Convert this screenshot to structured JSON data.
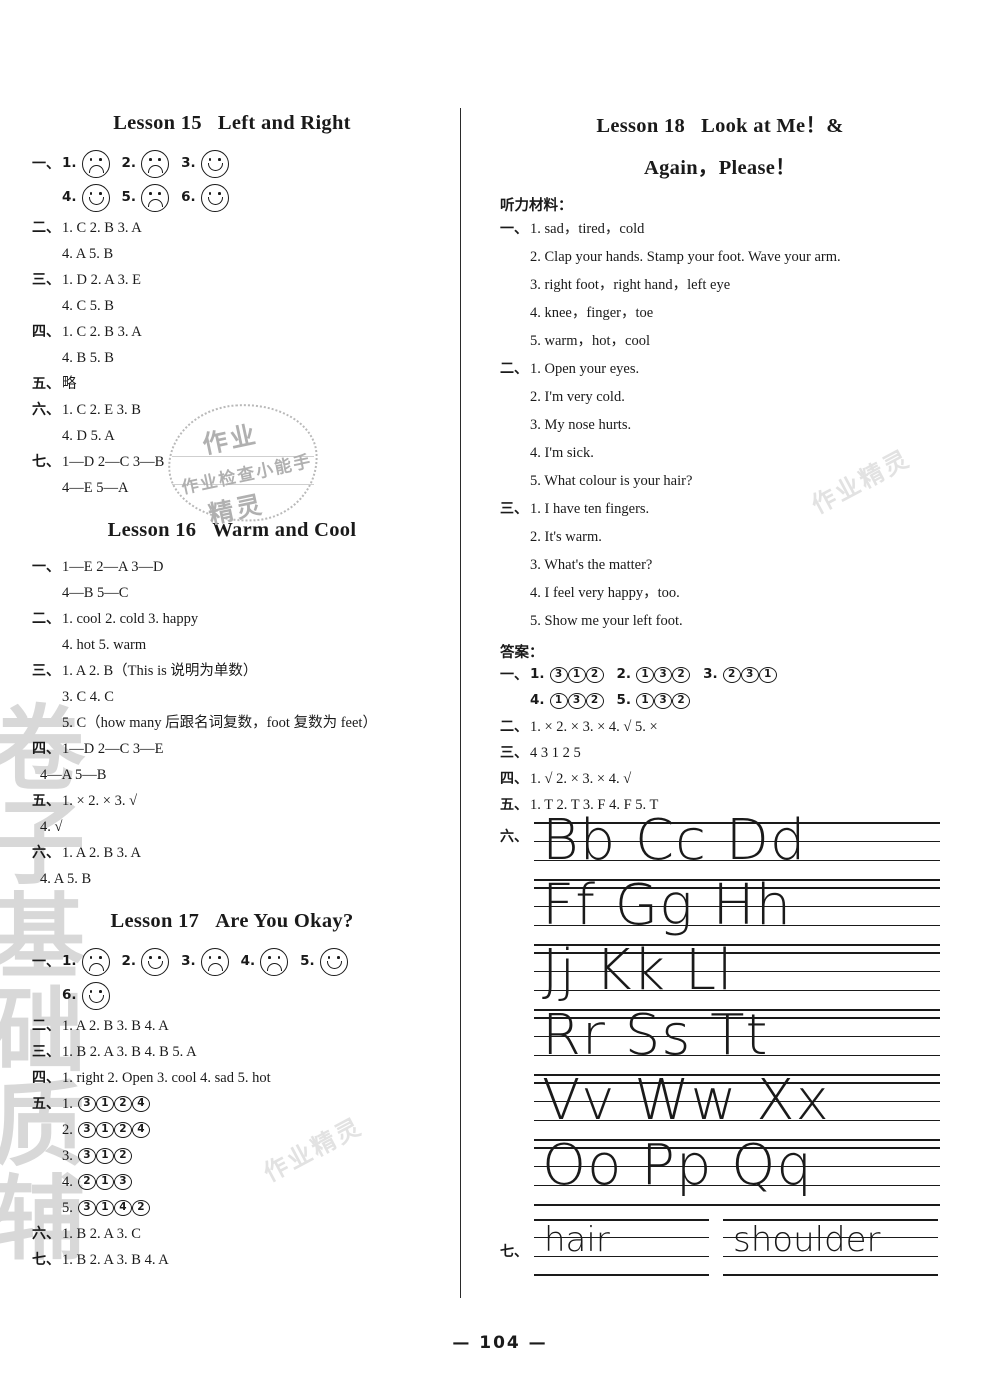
{
  "page": {
    "number": "— 104 —"
  },
  "watermarks": {
    "left_edge": "卷子基础质辅",
    "stamp": {
      "line1": "作业",
      "line2": "作业检查小能手",
      "line3": "精灵"
    },
    "small": [
      "作业精灵",
      "作业精灵",
      "作业精灵"
    ]
  },
  "left_column": {
    "lessons": [
      {
        "title_prefix": "Lesson 15",
        "title_name": "Left and Right",
        "sections": [
          {
            "cn": "一、",
            "rows": [
              {
                "items": [
                  {
                    "n": "1.",
                    "face": "sad"
                  },
                  {
                    "n": "2.",
                    "face": "sad"
                  },
                  {
                    "n": "3.",
                    "face": "happy"
                  }
                ]
              },
              {
                "indent": true,
                "items": [
                  {
                    "n": "4.",
                    "face": "happy"
                  },
                  {
                    "n": "5.",
                    "face": "sad"
                  },
                  {
                    "n": "6.",
                    "face": "happy"
                  }
                ]
              }
            ]
          },
          {
            "cn": "二、",
            "rows": [
              {
                "text": "1. C  2. B  3. A"
              },
              {
                "indent": true,
                "text": "4. A  5. B"
              }
            ]
          },
          {
            "cn": "三、",
            "rows": [
              {
                "text": "1. D  2. A  3. E"
              },
              {
                "indent": true,
                "text": "4. C  5. B"
              }
            ]
          },
          {
            "cn": "四、",
            "rows": [
              {
                "text": "1. C  2. B  3. A"
              },
              {
                "indent": true,
                "text": "4. B  5. B"
              }
            ]
          },
          {
            "cn": "五、",
            "rows": [
              {
                "text": "略"
              }
            ]
          },
          {
            "cn": "六、",
            "rows": [
              {
                "text": "1. C  2. E  3. B"
              },
              {
                "indent": true,
                "text": "4. D  5. A"
              }
            ]
          },
          {
            "cn": "七、",
            "rows": [
              {
                "text": "1—D  2—C  3—B"
              },
              {
                "indent": true,
                "text": "4—E  5—A"
              }
            ]
          }
        ]
      },
      {
        "title_prefix": "Lesson 16",
        "title_name": "Warm and Cool",
        "sections": [
          {
            "cn": "一、",
            "rows": [
              {
                "text": "1—E  2—A  3—D"
              },
              {
                "indent": true,
                "text": "4—B   5—C"
              }
            ]
          },
          {
            "cn": "二、",
            "rows": [
              {
                "text": "1. cool  2. cold  3. happy"
              },
              {
                "indent": true,
                "text": "4. hot  5. warm"
              }
            ]
          },
          {
            "cn": "三、",
            "rows": [
              {
                "text": "1. A  2. B（This is 说明为单数）"
              },
              {
                "indent": true,
                "text": "3. C  4. C"
              },
              {
                "indent": true,
                "text": "5. C（how many 后跟名词复数，foot 复数为 feet）"
              }
            ]
          },
          {
            "cn": "四、",
            "rows": [
              {
                "text": "1—D  2—C  3—E"
              },
              {
                "outdent": true,
                "text": "4—A  5—B"
              }
            ]
          },
          {
            "cn": "五、",
            "rows": [
              {
                "text": "1. ×  2. ×  3. √"
              },
              {
                "outdent": true,
                "text": "4. √"
              }
            ]
          },
          {
            "cn": "六、",
            "rows": [
              {
                "text": "1. A  2. B  3. A"
              },
              {
                "outdent": true,
                "text": "4. A  5. B"
              }
            ]
          }
        ]
      },
      {
        "title_prefix": "Lesson 17",
        "title_name": "Are You Okay?",
        "sections": [
          {
            "cn": "一、",
            "rows": [
              {
                "items": [
                  {
                    "n": "1.",
                    "face": "sad"
                  },
                  {
                    "n": "2.",
                    "face": "happy"
                  },
                  {
                    "n": "3.",
                    "face": "sad"
                  },
                  {
                    "n": "4.",
                    "face": "sad"
                  },
                  {
                    "n": "5.",
                    "face": "happy"
                  }
                ]
              },
              {
                "indent": true,
                "items": [
                  {
                    "n": "6.",
                    "face": "happy"
                  }
                ]
              }
            ]
          },
          {
            "cn": "二、",
            "rows": [
              {
                "text": "1. A  2. B  3. B  4. A"
              }
            ]
          },
          {
            "cn": "三、",
            "rows": [
              {
                "text": "1. B  2. A  3. B  4. B  5. A"
              }
            ]
          },
          {
            "cn": "四、",
            "rows": [
              {
                "text": "1. right  2. Open  3. cool  4. sad  5. hot"
              }
            ]
          },
          {
            "cn": "五、",
            "rows": [
              {
                "text": "1.",
                "circled": [
                  "3",
                  "1",
                  "2",
                  "4"
                ]
              },
              {
                "indent": true,
                "text": "2.",
                "circled": [
                  "3",
                  "1",
                  "2",
                  "4"
                ]
              },
              {
                "indent": true,
                "text": "3.",
                "circled": [
                  "3",
                  "1",
                  "2"
                ]
              },
              {
                "indent": true,
                "text": "4.",
                "circled": [
                  "2",
                  "1",
                  "3"
                ]
              },
              {
                "indent": true,
                "text": "5.",
                "circled": [
                  "3",
                  "1",
                  "4",
                  "2"
                ]
              }
            ]
          },
          {
            "cn": "六、",
            "rows": [
              {
                "text": "1. B  2. A  3. C"
              }
            ]
          },
          {
            "cn": "七、",
            "rows": [
              {
                "text": "1. B  2. A  3. B  4. A"
              }
            ]
          }
        ]
      }
    ]
  },
  "right_column": {
    "lesson": {
      "title_line1_prefix": "Lesson 18",
      "title_line1_name": "Look at Me！&",
      "title_line2": "Again，Please！"
    },
    "listening_heading": "听力材料：",
    "listening": [
      {
        "cn": "一、",
        "items": [
          "1. sad，tired，cold",
          "2. Clap your hands.  Stamp your foot.  Wave your arm.",
          "3. right foot，right hand，left eye",
          "4. knee，finger，toe",
          "5. warm，hot，cool"
        ]
      },
      {
        "cn": "二、",
        "items": [
          "1. Open your eyes.",
          "2. I'm very cold.",
          "3. My nose hurts.",
          "4. I'm sick.",
          "5. What colour is your hair?"
        ]
      },
      {
        "cn": "三、",
        "items": [
          "1. I have ten fingers.",
          "2. It's warm.",
          "3. What's the matter?",
          "4. I feel very happy，too.",
          "5. Show me your left foot."
        ]
      }
    ],
    "answers_heading": "答案：",
    "answers": [
      {
        "cn": "一、",
        "rows": [
          {
            "pairs": [
              {
                "n": "1.",
                "circled": [
                  "3",
                  "1",
                  "2"
                ]
              },
              {
                "n": "2.",
                "circled": [
                  "1",
                  "3",
                  "2"
                ]
              },
              {
                "n": "3.",
                "circled": [
                  "2",
                  "3",
                  "1"
                ]
              }
            ]
          },
          {
            "indent": true,
            "pairs": [
              {
                "n": "4.",
                "circled": [
                  "1",
                  "3",
                  "2"
                ]
              },
              {
                "n": "5.",
                "circled": [
                  "1",
                  "3",
                  "2"
                ]
              }
            ]
          }
        ]
      },
      {
        "cn": "二、",
        "rows": [
          {
            "text": "1. ×  2. ×  3. ×  4. √  5. ×"
          }
        ]
      },
      {
        "cn": "三、",
        "rows": [
          {
            "text": "4 3 1 2 5"
          }
        ]
      },
      {
        "cn": "四、",
        "rows": [
          {
            "text": "1. √  2. ×  3. ×  4. √"
          }
        ]
      },
      {
        "cn": "五、",
        "rows": [
          {
            "text": "1. T  2. T  3. F  4. F  5. T"
          }
        ]
      }
    ],
    "handwriting": {
      "cn": "六、",
      "lines": [
        "Bb Cc Dd",
        "Ff Gg Hh",
        "Jj Kk Ll",
        "Rr Ss Tt",
        "Vv Ww Xx",
        "Oo Pp Qq"
      ]
    },
    "words": {
      "cn": "七、",
      "items": [
        "hair",
        "shoulder"
      ]
    }
  }
}
